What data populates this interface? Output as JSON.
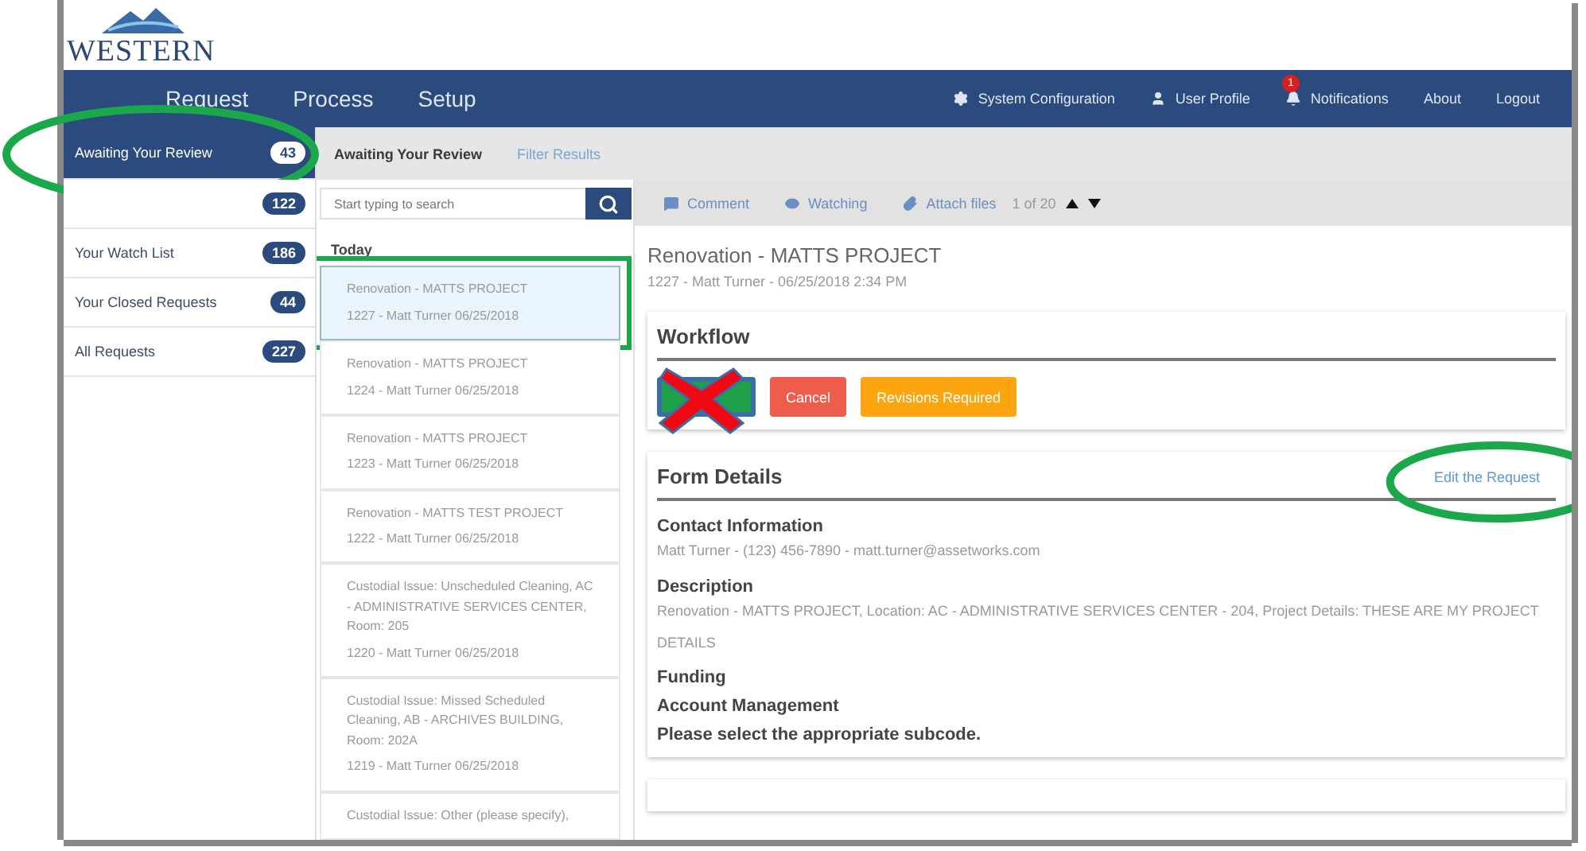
{
  "logo": {
    "text": "WESTERN"
  },
  "nav": {
    "main": [
      {
        "label": "Request"
      },
      {
        "label": "Process"
      },
      {
        "label": "Setup"
      }
    ],
    "right": [
      {
        "label": "System Configuration"
      },
      {
        "label": "User Profile"
      },
      {
        "label": "Notifications",
        "badge": "1"
      },
      {
        "label": "About"
      },
      {
        "label": "Logout"
      }
    ]
  },
  "sidebar": {
    "items": [
      {
        "label": "Awaiting Your Review",
        "count": "43",
        "selected": true,
        "circled": true
      },
      {
        "count": "122",
        "selected": false,
        "circled": false
      },
      {
        "label": "Your Watch List",
        "count": "186",
        "selected": false,
        "circled": false
      },
      {
        "label": "Your Closed Requests",
        "count": "44",
        "selected": false,
        "circled": false
      },
      {
        "label": "All Requests",
        "count": "227",
        "selected": false,
        "circled": false
      }
    ]
  },
  "subheader": {
    "title": "Awaiting Your Review",
    "link": "Filter Results"
  },
  "search": {
    "placeholder": "Start typing to search"
  },
  "list": {
    "group": "Today",
    "items": [
      {
        "title": "Renovation - MATTS PROJECT",
        "meta": "1227 - Matt Turner 06/25/2018",
        "selected": true,
        "boxed": true
      },
      {
        "title": "Renovation - MATTS PROJECT",
        "meta": "1224 - Matt Turner 06/25/2018",
        "selected": false,
        "boxed": false
      },
      {
        "title": "Renovation - MATTS PROJECT",
        "meta": "1223 - Matt Turner 06/25/2018",
        "selected": false,
        "boxed": false
      },
      {
        "title": "Renovation - MATTS TEST PROJECT",
        "meta": "1222 - Matt Turner 06/25/2018",
        "selected": false,
        "boxed": false
      },
      {
        "title": "Custodial Issue: Unscheduled Cleaning, AC - ADMINISTRATIVE SERVICES CENTER, Room: 205",
        "meta": "1220 - Matt Turner 06/25/2018",
        "selected": false,
        "boxed": false
      },
      {
        "title": "Custodial Issue: Missed Scheduled Cleaning, AB - ARCHIVES BUILDING, Room: 202A",
        "meta": "1219 - Matt Turner 06/25/2018",
        "selected": false,
        "boxed": false
      },
      {
        "title": "Custodial Issue: Other (please specify),",
        "selected": false,
        "boxed": false
      }
    ]
  },
  "toolbar": {
    "actions": [
      {
        "label": "Comment"
      },
      {
        "label": "Watching"
      },
      {
        "label": "Attach files"
      }
    ],
    "pager": "1 of 20"
  },
  "request": {
    "title": "Renovation - MATTS PROJECT",
    "meta": "1227 - Matt Turner - 06/25/2018 2:34 PM"
  },
  "workflow": {
    "title": "Workflow",
    "buttons": [
      {
        "kind": "approve",
        "crossed_out": true
      },
      {
        "label": "Cancel",
        "kind": "cancel",
        "crossed_out": false
      },
      {
        "label": "Revisions Required",
        "kind": "revise",
        "crossed_out": false
      }
    ]
  },
  "form": {
    "title": "Form Details",
    "edit_link": {
      "label": "Edit the Request",
      "circled": true
    },
    "sections": [
      {
        "heading": "Contact Information",
        "text": "Matt Turner - (123) 456-7890 - matt.turner@assetworks.com"
      },
      {
        "heading": "Description",
        "text": "Renovation - MATTS PROJECT, Location: AC - ADMINISTRATIVE SERVICES CENTER - 204, Project Details: THESE ARE MY PROJECT DETAILS"
      },
      {
        "heading": "Funding"
      },
      {
        "heading": "Account Management"
      },
      {
        "heading": "Please select the appropriate subcode."
      }
    ]
  }
}
